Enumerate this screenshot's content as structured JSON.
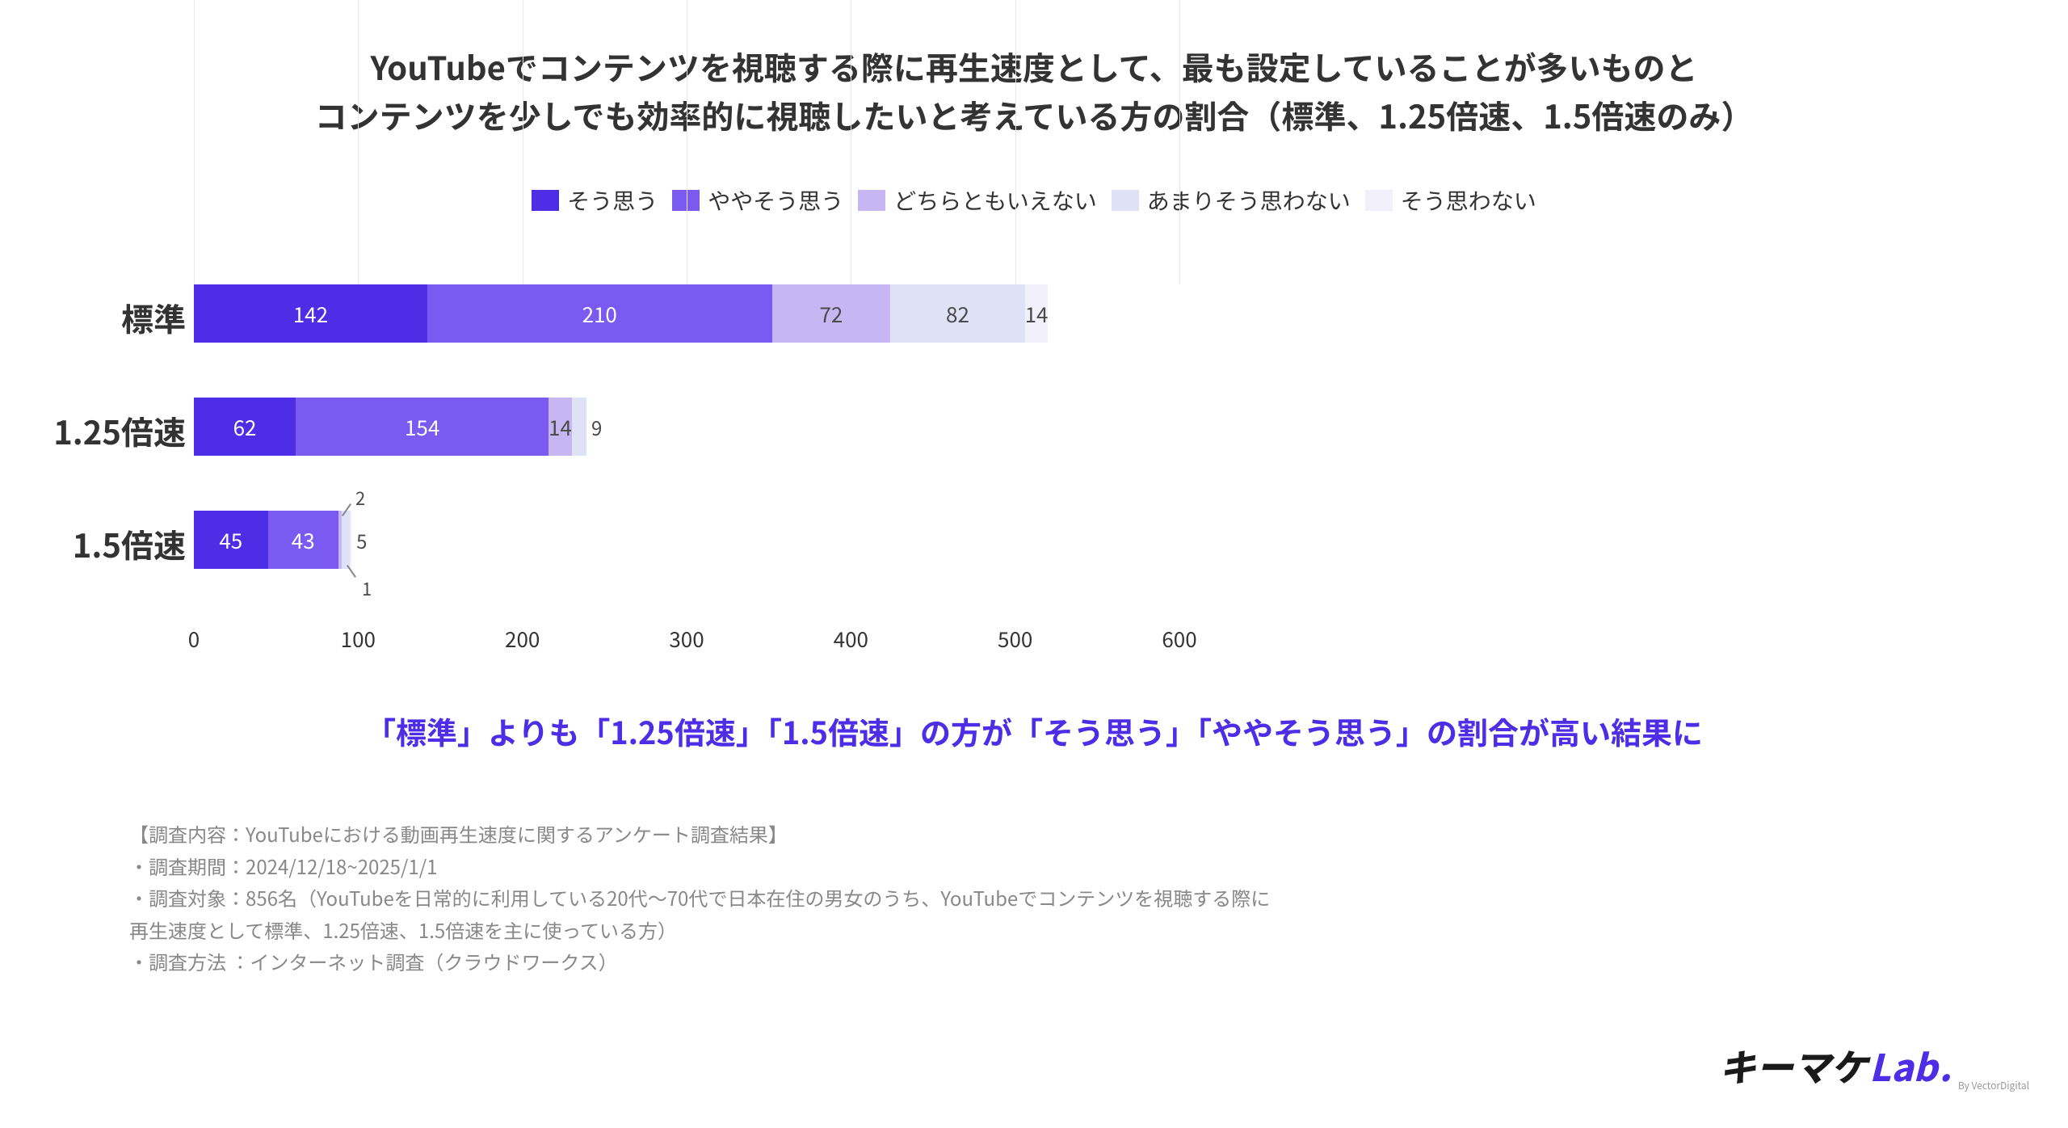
{
  "title_line1": "YouTubeでコンテンツを視聴する際に再生速度として、最も設定していることが多いものと",
  "title_line2": "コンテンツを少しでも効率的に視聴したいと考えている方の割合（標準、1.25倍速、1.5倍速のみ）",
  "legend": {
    "s1": "そう思う",
    "s2": "ややそう思う",
    "s3": "どちらともいえない",
    "s4": "あまりそう思わない",
    "s5": "そう思わない"
  },
  "colors": {
    "s1": "#4d2ee6",
    "s2": "#7a5af0",
    "s3": "#c6b7f2",
    "s4": "#dfe1f7",
    "s5": "#f1f0fb"
  },
  "chart_data": {
    "type": "bar",
    "orientation": "horizontal_stacked",
    "categories": [
      "標準",
      "1.25倍速",
      "1.5倍速"
    ],
    "series": [
      {
        "name": "そう思う",
        "values": [
          142,
          62,
          45
        ]
      },
      {
        "name": "ややそう思う",
        "values": [
          210,
          154,
          43
        ]
      },
      {
        "name": "どちらともいえない",
        "values": [
          72,
          14,
          2
        ]
      },
      {
        "name": "あまりそう思わない",
        "values": [
          82,
          9,
          5
        ]
      },
      {
        "name": "そう思わない",
        "values": [
          14,
          0,
          1
        ]
      }
    ],
    "xlabel": "",
    "ylabel": "",
    "xlim": [
      0,
      600
    ],
    "xticks": [
      0,
      100,
      200,
      300,
      400,
      500,
      600
    ]
  },
  "axis_ticks": {
    "t0": "0",
    "t1": "100",
    "t2": "200",
    "t3": "300",
    "t4": "400",
    "t5": "500",
    "t6": "600"
  },
  "row_labels": {
    "r0": "標準",
    "r1": "1.25倍速",
    "r2": "1.5倍速"
  },
  "vals": {
    "r0": {
      "s1": "142",
      "s2": "210",
      "s3": "72",
      "s4": "82",
      "s5": "14"
    },
    "r1": {
      "s1": "62",
      "s2": "154",
      "s3": "14",
      "s4": "9"
    },
    "r2": {
      "s1": "45",
      "s2": "43",
      "s3": "2",
      "s4": "5",
      "s5": "1"
    }
  },
  "conclusion": "「標準」よりも「1.25倍速」「1.5倍速」の方が「そう思う」「ややそう思う」の割合が高い結果に",
  "meta": {
    "m0": "【調査内容：YouTubeにおける動画再生速度に関するアンケート調査結果】",
    "m1": "・調査期間：2024/12/18~2025/1/1",
    "m2": "・調査対象：856名（YouTubeを日常的に利用している20代〜70代で日本在住の男女のうち、YouTubeでコンテンツを視聴する際に",
    "m3": "再生速度として標準、1.25倍速、1.5倍速を主に使っている方）",
    "m4": "・調査方法 ：インターネット調査（クラウドワークス）"
  },
  "logo": {
    "part1": "キーマケ",
    "part2": "Lab",
    "dot": ".",
    "sub": "By VectorDigital"
  }
}
